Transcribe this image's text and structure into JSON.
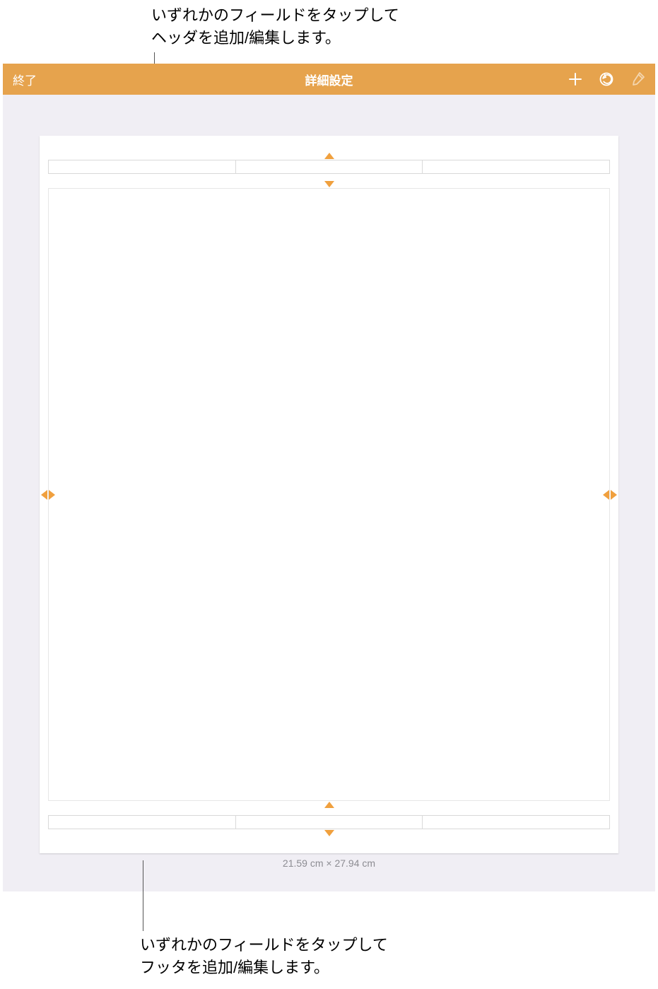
{
  "callouts": {
    "header": "いずれかのフィールドをタップして\nヘッダを追加/編集します。",
    "footer": "いずれかのフィールドをタップして\nフッタを追加/編集します。"
  },
  "toolbar": {
    "done_label": "終了",
    "title": "詳細設定"
  },
  "icons": {
    "add": "add-icon",
    "undo": "undo-icon",
    "format": "format-brush-icon"
  },
  "page": {
    "size_label": "21.59 cm × 27.94 cm"
  },
  "colors": {
    "accent": "#e6a34d",
    "guide": "#f0a03e",
    "canvas_bg": "#f0eef4"
  }
}
